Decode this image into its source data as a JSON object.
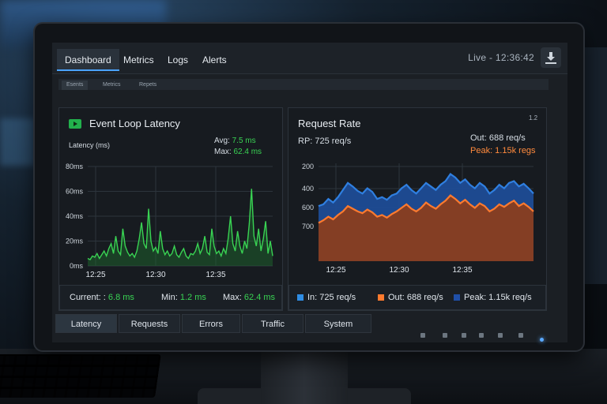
{
  "header": {
    "tabs": [
      {
        "label": "Dashboard",
        "active": true
      },
      {
        "label": "Metrics",
        "active": false
      },
      {
        "label": "Logs",
        "active": false
      },
      {
        "label": "Alerts",
        "active": false
      }
    ],
    "live_label": "Live - 12:36:42"
  },
  "subtabs": [
    {
      "label": "Esents",
      "active": true
    },
    {
      "label": "Metrics",
      "active": false
    },
    {
      "label": "Repets",
      "active": false
    }
  ],
  "latency_panel": {
    "title": "Event Loop Latency",
    "ylabel": "Latency (ms)",
    "avg_label": "Avg:",
    "avg_value": "7.5 ms",
    "max_label": "Max:",
    "max_value": "62.4 ms",
    "current_label": "Current: :",
    "current_value": "6.8 ms",
    "min_label": "Min:",
    "min_value": "1.2 ms",
    "max2_label": "Max:",
    "max2_value": "62.4 ms"
  },
  "request_panel": {
    "title": "Request Rate",
    "corner": "1.2",
    "rp_label": "RP: 725 req/s",
    "out_label": "Out: 688 req/s",
    "peak_label": "Peak: 1.15k regs",
    "legend": [
      {
        "label": "In: 725 req/s",
        "color": "#2f8de4"
      },
      {
        "label": "Out: 688 req/s",
        "color": "#ff7a2e"
      },
      {
        "label": "Peak: 1.15k req/s",
        "color": "#1f4fa8"
      }
    ]
  },
  "bottom_tabs": [
    {
      "label": "Latency",
      "active": true
    },
    {
      "label": "Requests",
      "active": false
    },
    {
      "label": "Errors",
      "active": false
    },
    {
      "label": "Traffic",
      "active": false
    },
    {
      "label": "System",
      "active": false
    }
  ],
  "colors": {
    "latency_line": "#39d353",
    "in_area": "#2f7fe0",
    "out_area": "#ff7a2e",
    "accent": "#4aa3ff"
  },
  "chart_data": [
    {
      "type": "line",
      "title": "Event Loop Latency",
      "ylabel": "Latency (ms)",
      "xlabel": "",
      "x_ticks": [
        "12:25",
        "12:30",
        "12:35"
      ],
      "y_ticks": [
        "0ms",
        "20ms",
        "40ms",
        "60ms",
        "80ms"
      ],
      "ylim": [
        0,
        80
      ],
      "series": [
        {
          "values": [
            6,
            5,
            8,
            7,
            10,
            6,
            9,
            12,
            8,
            14,
            18,
            10,
            24,
            12,
            9,
            30,
            16,
            11,
            8,
            10,
            7,
            12,
            22,
            35,
            18,
            14,
            46,
            20,
            12,
            15,
            10,
            28,
            14,
            9,
            12,
            8,
            10,
            16,
            9,
            7,
            11,
            14,
            8,
            6,
            10,
            9,
            12,
            18,
            10,
            14,
            24,
            11,
            9,
            30,
            16,
            10,
            12,
            8,
            14,
            10,
            22,
            40,
            18,
            12,
            28,
            16,
            10,
            20,
            14,
            34,
            62,
            24,
            16,
            30,
            12,
            22,
            36,
            10,
            20,
            8
          ]
        }
      ]
    },
    {
      "type": "area",
      "title": "Request Rate",
      "x_ticks": [
        "12:25",
        "12:30",
        "12:35"
      ],
      "y_ticks": [
        "400",
        "600",
        "700",
        "200"
      ],
      "series": [
        {
          "name": "In",
          "values": [
            620,
            640,
            700,
            660,
            720,
            800,
            880,
            840,
            790,
            760,
            820,
            780,
            700,
            720,
            690,
            740,
            760,
            820,
            860,
            800,
            760,
            820,
            880,
            840,
            800,
            860,
            900,
            980,
            940,
            880,
            920,
            860,
            820,
            880,
            840,
            760,
            800,
            860,
            820,
            880,
            900,
            840,
            870,
            820,
            760
          ]
        },
        {
          "name": "Out",
          "values": [
            430,
            460,
            500,
            470,
            520,
            560,
            620,
            590,
            560,
            540,
            580,
            550,
            500,
            520,
            490,
            530,
            560,
            600,
            640,
            590,
            560,
            600,
            660,
            620,
            590,
            640,
            680,
            740,
            700,
            650,
            690,
            640,
            600,
            650,
            620,
            560,
            590,
            640,
            610,
            650,
            680,
            620,
            650,
            610,
            560
          ]
        }
      ]
    }
  ]
}
